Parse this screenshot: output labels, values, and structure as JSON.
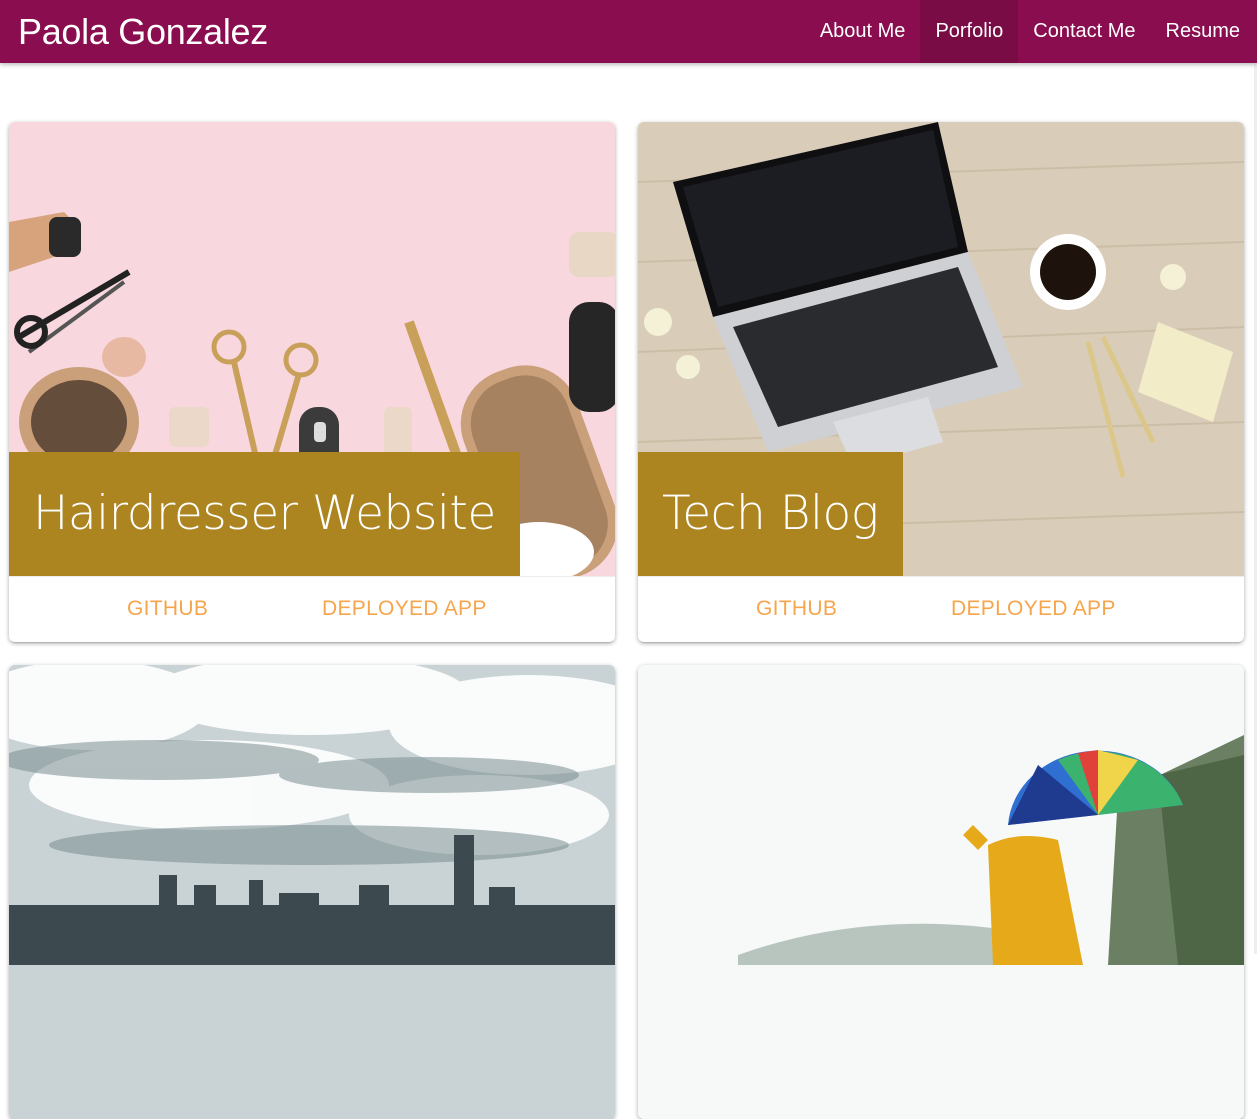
{
  "navbar": {
    "brand": "Paola Gonzalez",
    "links": [
      "About Me",
      "Porfolio",
      "Contact Me",
      "Resume"
    ],
    "active": "Porfolio",
    "color": "#8a0d4f"
  },
  "projects": [
    {
      "title": "Hairdresser Website",
      "github_label": "GITHUB",
      "deployed_label": "DEPLOYED APP",
      "image": "hairdresser-tools-photo"
    },
    {
      "title": "Tech Blog",
      "github_label": "GITHUB",
      "deployed_label": "DEPLOYED APP",
      "image": "laptop-desk-photo"
    },
    {
      "title": "",
      "image": "city-skyline-clouds-photo"
    },
    {
      "title": "",
      "image": "umbrella-person-photo"
    }
  ],
  "colors": {
    "title_overlay": "#ac8420",
    "action_link": "#f6a54c"
  }
}
